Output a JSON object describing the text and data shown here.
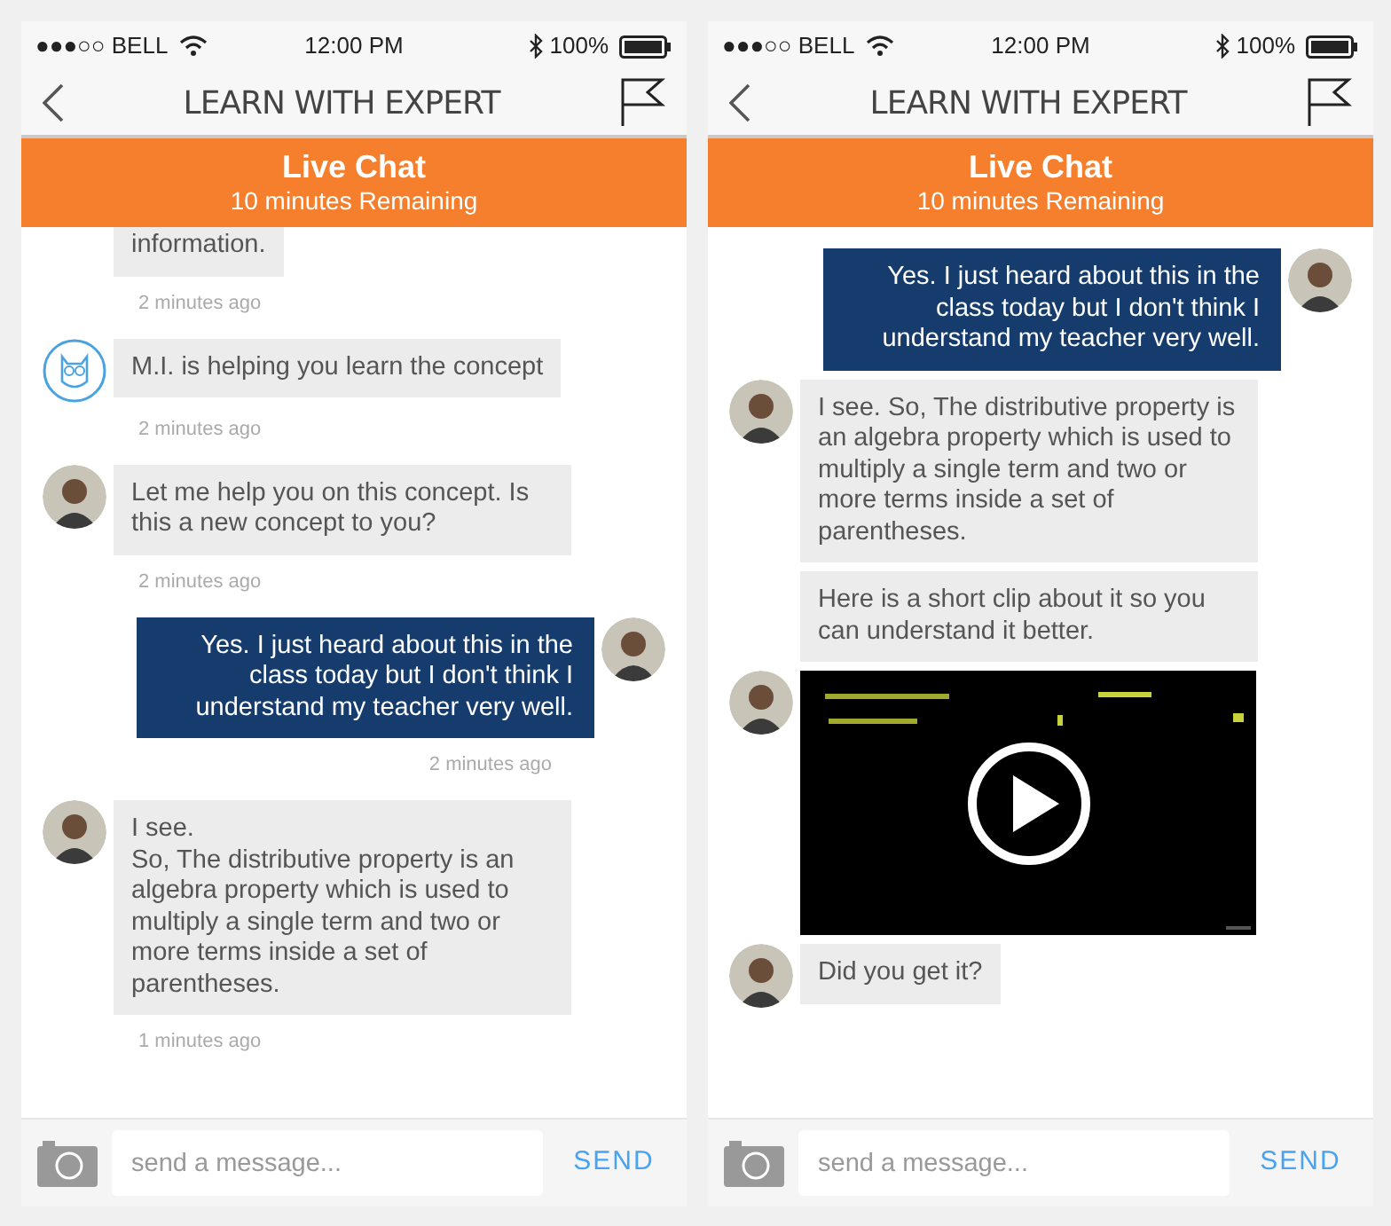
{
  "screens": [
    {
      "status_bar": {
        "carrier": "●●●○○ BELL",
        "time": "12:00 PM",
        "battery": "100%"
      },
      "header": {
        "title": "LEARN WITH EXPERT"
      },
      "banner": {
        "title": "Live Chat",
        "subtitle": "10 minutes Remaining"
      },
      "messages": [
        {
          "kind": "received",
          "lines": [
            "information."
          ],
          "time": "2 minutes ago"
        },
        {
          "kind": "received",
          "avatar": {
            "kind": "owl"
          },
          "lines": [
            "M.I. is helping you learn the concept"
          ],
          "time": "2 minutes ago"
        },
        {
          "kind": "received",
          "avatar": {
            "kind": "person"
          },
          "lines": [
            "Let me help you on this concept. Is this a new concept to you?"
          ],
          "time": "2 minutes ago"
        },
        {
          "kind": "sent",
          "avatar": {
            "kind": "person"
          },
          "lines": [
            "Yes. I just heard about this in the class today but I don't think I understand my teacher very well."
          ],
          "time": "2 minutes ago"
        },
        {
          "kind": "received",
          "avatar": {
            "kind": "person"
          },
          "lines": [
            "I see.",
            "So, The distributive property is an algebra property which is used to multiply a single term and two or more terms inside a set of parentheses."
          ],
          "time": "1 minutes ago"
        }
      ],
      "composer": {
        "placeholder": "send a message...",
        "send": "SEND"
      }
    },
    {
      "status_bar": {
        "carrier": "●●●○○ BELL",
        "time": "12:00 PM",
        "battery": "100%"
      },
      "header": {
        "title": "LEARN WITH EXPERT"
      },
      "banner": {
        "title": "Live Chat",
        "subtitle": "10 minutes Remaining"
      },
      "messages": [
        {
          "kind": "sent",
          "avatar": {
            "kind": "person"
          },
          "lines": [
            "Yes. I just heard about this in the class today but I don't think I understand my teacher very well."
          ]
        },
        {
          "kind": "received",
          "avatar": {
            "kind": "person"
          },
          "lines": [
            "I see. So, The distributive property is an algebra property which is used to multiply a single term and two or more terms inside a set of parentheses."
          ]
        },
        {
          "kind": "received",
          "lines": [
            "Here is a short clip about it so you can understand it better."
          ]
        },
        {
          "kind": "video",
          "avatar": {
            "kind": "person"
          }
        },
        {
          "kind": "received",
          "avatar": {
            "kind": "person"
          },
          "lines": [
            "Did you get it?"
          ]
        }
      ],
      "composer": {
        "placeholder": "send a message...",
        "send": "SEND"
      }
    }
  ]
}
